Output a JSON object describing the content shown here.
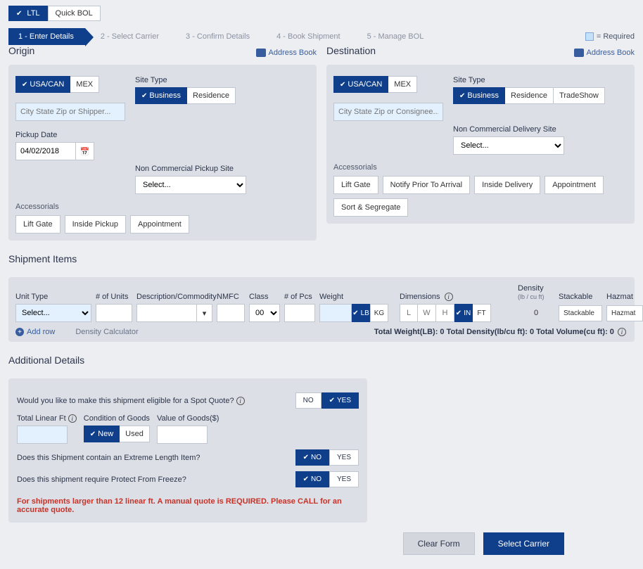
{
  "top_tabs": {
    "ltl": "LTL",
    "quick_bol": "Quick BOL"
  },
  "wizard": {
    "s1": "1 - Enter Details",
    "s2": "2 - Select Carrier",
    "s3": "3 - Confirm Details",
    "s4": "4 - Book Shipment",
    "s5": "5 - Manage BOL",
    "required": "= Required"
  },
  "origin": {
    "title": "Origin",
    "address_book": "Address Book",
    "country_usa": "USA/CAN",
    "country_mex": "MEX",
    "search_ph": "City State Zip or Shipper...",
    "site_type": "Site Type",
    "st_business": "Business",
    "st_residence": "Residence",
    "pickup_date": "Pickup Date",
    "date_value": "04/02/2018",
    "noncom_label": "Non Commercial Pickup Site",
    "noncom_ph": "Select...",
    "accessorials": "Accessorials",
    "acc_lift": "Lift Gate",
    "acc_inside": "Inside Pickup",
    "acc_appt": "Appointment"
  },
  "destination": {
    "title": "Destination",
    "address_book": "Address Book",
    "country_usa": "USA/CAN",
    "country_mex": "MEX",
    "search_ph": "City State Zip or Consignee...",
    "site_type": "Site Type",
    "st_business": "Business",
    "st_residence": "Residence",
    "st_trade": "TradeShow",
    "noncom_label": "Non Commercial Delivery Site",
    "noncom_ph": "Select...",
    "accessorials": "Accessorials",
    "acc_lift": "Lift Gate",
    "acc_notify": "Notify Prior To Arrival",
    "acc_inside": "Inside Delivery",
    "acc_appt": "Appointment",
    "acc_sort": "Sort & Segregate"
  },
  "items": {
    "title": "Shipment Items",
    "unit_type": "Unit Type",
    "num_units": "# of Units",
    "desc": "Description/Commodity",
    "nmfc": "NMFC",
    "class": "Class",
    "pcs": "# of Pcs",
    "weight": "Weight",
    "dimensions": "Dimensions",
    "density": "Density",
    "density_sub": "(lb / cu ft)",
    "stackable": "Stackable",
    "hazmat": "Hazmat",
    "unit_select": "Select...",
    "class_val": "00",
    "lb": "LB",
    "kg": "KG",
    "l": "L",
    "w": "W",
    "h": "H",
    "in": "IN",
    "ft": "FT",
    "density_val": "0",
    "stack_btn": "Stackable",
    "hazmat_btn": "Hazmat",
    "add_row": "Add row",
    "density_calc": "Density Calculator",
    "totals": "Total Weight(LB): 0    Total Density(lb/cu ft): 0    Total Volume(cu ft): 0"
  },
  "details": {
    "title": "Additional Details",
    "spot_q": "Would you like to make this shipment eligible for a Spot Quote?",
    "no": "NO",
    "yes": "YES",
    "linear": "Total Linear Ft",
    "condition": "Condition of Goods",
    "value": "Value of Goods($)",
    "new": "New",
    "used": "Used",
    "extreme": "Does this Shipment contain an Extreme Length Item?",
    "freeze": "Does this shipment require Protect From Freeze?",
    "warn": "For shipments larger than 12 linear ft. A manual quote is REQUIRED. Please CALL for an accurate quote."
  },
  "footer": {
    "clear": "Clear Form",
    "next": "Select Carrier"
  }
}
